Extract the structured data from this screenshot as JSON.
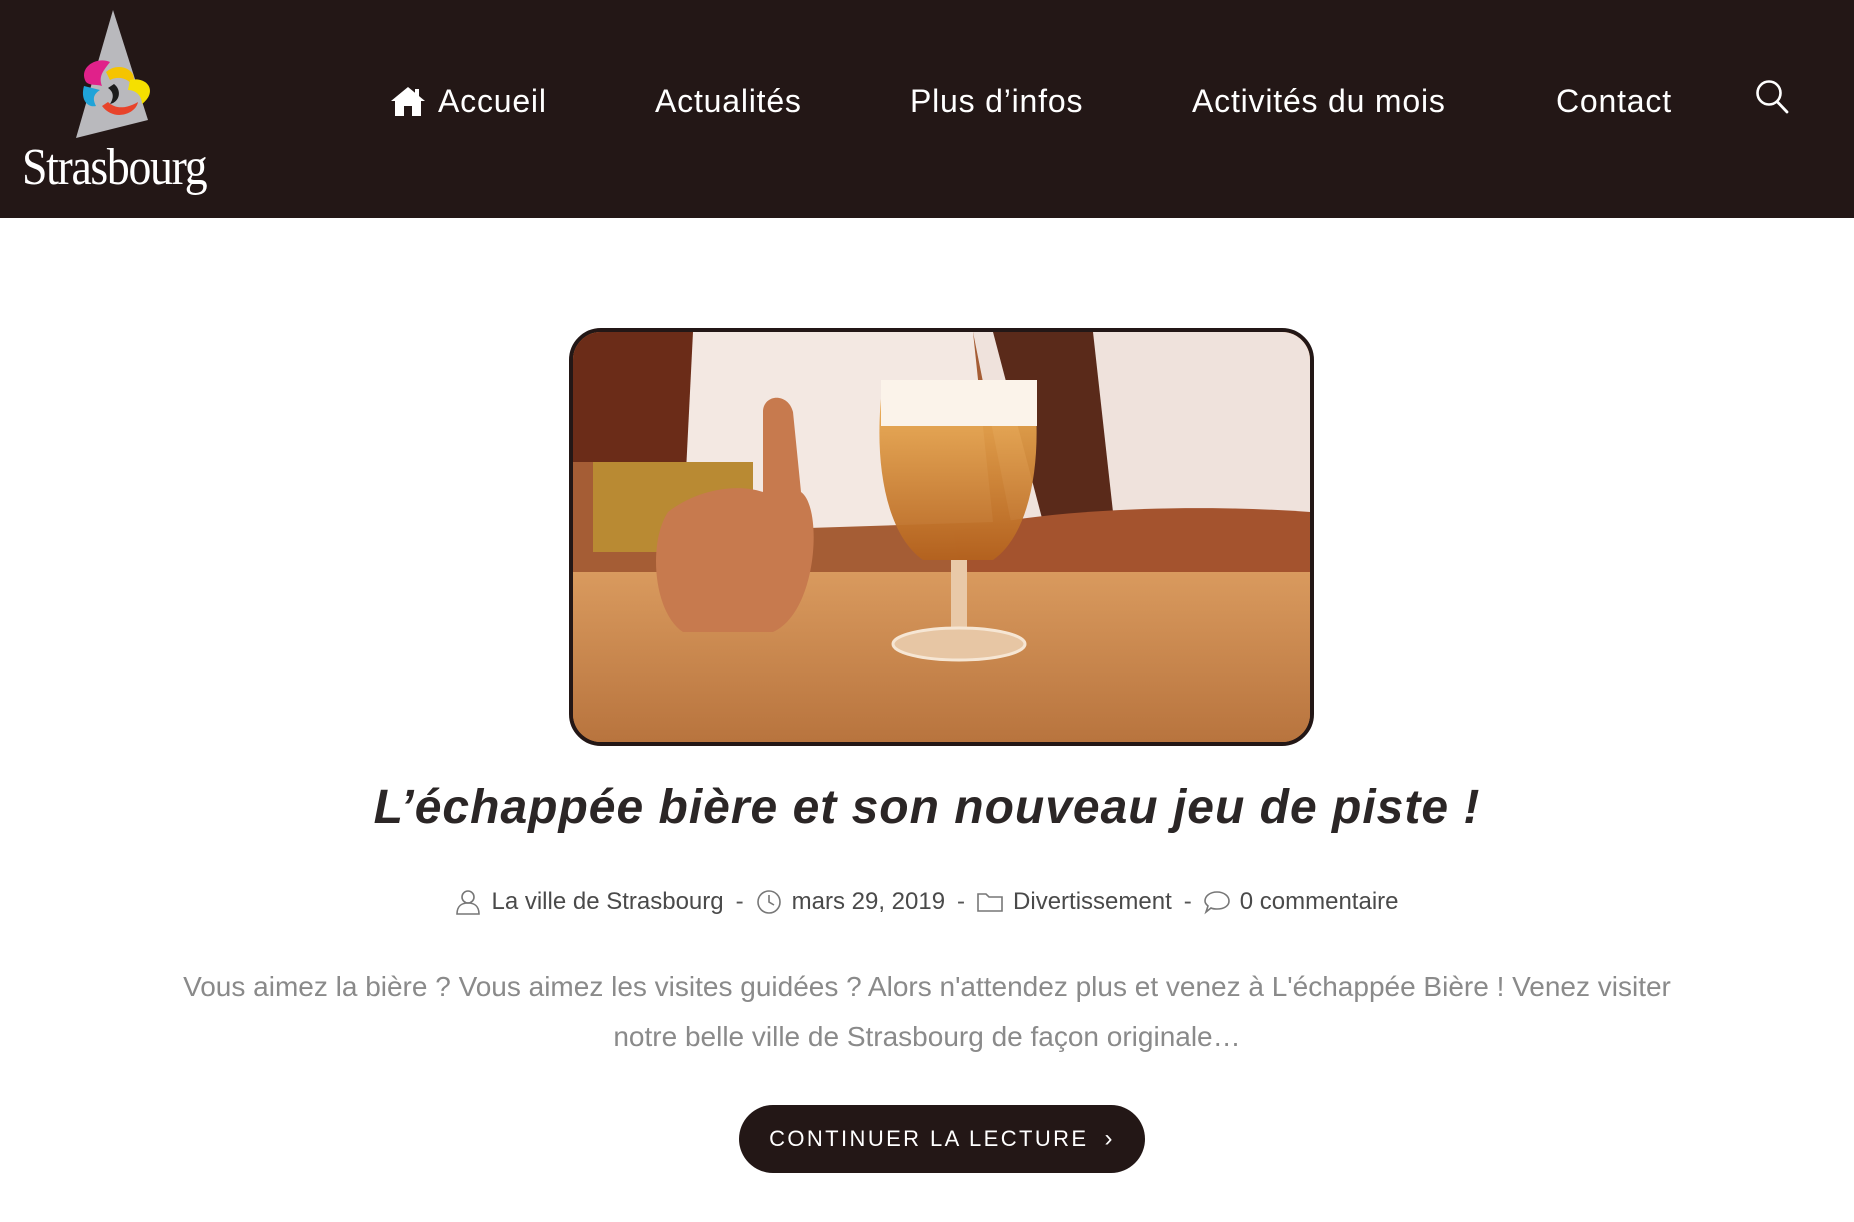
{
  "site": {
    "logo_text": "Strasbourg",
    "logo_icon": "strasbourg-cathedral-logo"
  },
  "nav": {
    "items": [
      {
        "label": "Accueil",
        "icon": "home-icon"
      },
      {
        "label": "Actualités"
      },
      {
        "label": "Plus d’infos"
      },
      {
        "label": "Activités du mois"
      },
      {
        "label": "Contact"
      }
    ],
    "search_icon": "search-icon"
  },
  "article": {
    "image_alt": "beer-glass-thumbs-up-photo",
    "title": "L’échappée bière et son nouveau jeu de piste !",
    "meta": {
      "author": "La ville de Strasbourg",
      "date": "mars 29, 2019",
      "category": "Divertissement",
      "comments": "0 commentaire",
      "separator": "-"
    },
    "excerpt": "Vous aimez la bière ? Vous aimez les visites guidées ? Alors n'attendez plus et venez à L'échappée Bière ! Venez visiter notre belle ville de Strasbourg de façon originale…",
    "cta_label": "CONTINUER LA LECTURE",
    "cta_chevron": "›"
  },
  "colors": {
    "header_bg": "#231716",
    "accent": "#231716",
    "text_dark": "#2b2626",
    "text_muted": "#8a8a8a"
  }
}
